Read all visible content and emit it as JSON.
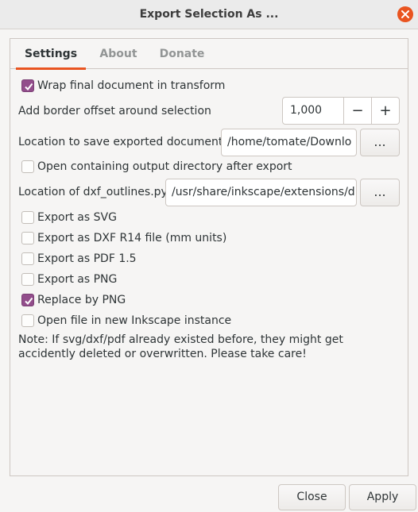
{
  "window": {
    "title": "Export Selection As ..."
  },
  "tabs": [
    {
      "label": "Settings",
      "active": true
    },
    {
      "label": "About",
      "active": false
    },
    {
      "label": "Donate",
      "active": false
    }
  ],
  "settings": {
    "wrap_transform": {
      "label": "Wrap final document in transform",
      "checked": true
    },
    "border_offset": {
      "label": "Add border offset around selection",
      "value": "1,000",
      "minus": "−",
      "plus": "+"
    },
    "save_location": {
      "label": "Location to save exported documents",
      "value": "/home/tomate/Downlo",
      "browse": "..."
    },
    "open_dir": {
      "label": "Open containing output directory after export",
      "checked": false
    },
    "dxf_location": {
      "label": "Location of dxf_outlines.py",
      "value": "/usr/share/inkscape/extensions/d",
      "browse": "..."
    },
    "export_svg": {
      "label": "Export as SVG",
      "checked": false
    },
    "export_dxf": {
      "label": "Export as DXF R14 file (mm units)",
      "checked": false
    },
    "export_pdf": {
      "label": "Export as PDF 1.5",
      "checked": false
    },
    "export_png": {
      "label": "Export as PNG",
      "checked": false
    },
    "replace_png": {
      "label": "Replace by PNG",
      "checked": true
    },
    "open_new_instance": {
      "label": "Open file in new Inkscape instance",
      "checked": false
    },
    "note": "Note: If svg/dxf/pdf already existed before, they might get accidently deleted or overwritten. Please take care!"
  },
  "footer": {
    "close_label": "Close",
    "apply_label": "Apply"
  },
  "colors": {
    "accent": "#e95420",
    "checkbox_checked": "#924d8b"
  }
}
